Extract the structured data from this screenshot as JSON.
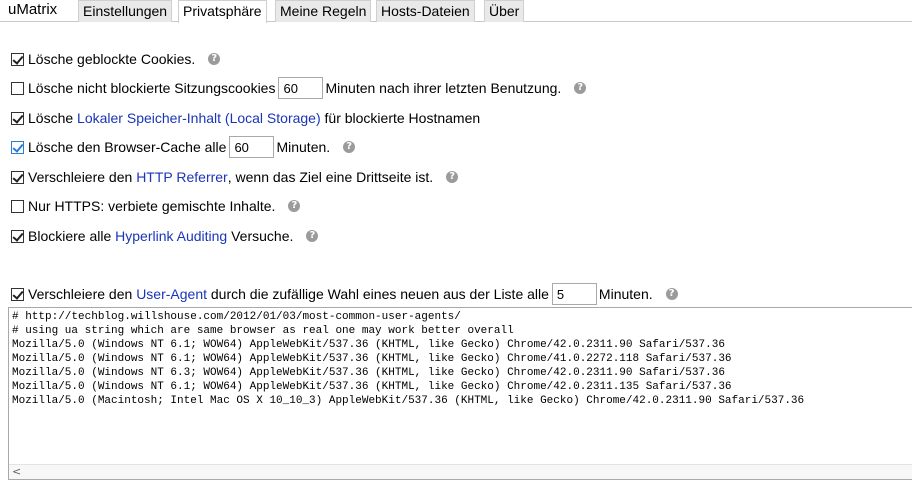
{
  "app": {
    "brand": "uMatrix"
  },
  "tabs": [
    {
      "label": "Einstellungen",
      "active": false
    },
    {
      "label": "Privatsphäre",
      "active": true
    },
    {
      "label": "Meine Regeln",
      "active": false
    },
    {
      "label": "Hosts-Dateien",
      "active": false
    },
    {
      "label": "Über",
      "active": false
    }
  ],
  "options": {
    "delete_blocked_cookies": {
      "checked": true,
      "label": "Lösche geblockte Cookies."
    },
    "delete_session_cookies": {
      "checked": false,
      "label_before": "Lösche nicht blockierte Sitzungscookies",
      "value": "60",
      "label_after": "Minuten nach ihrer letzten Benutzung."
    },
    "delete_local_storage": {
      "checked": true,
      "label_before": "Lösche",
      "link": "Lokaler Speicher-Inhalt (Local Storage)",
      "label_after": "für blockierte Hostnamen"
    },
    "clear_browser_cache": {
      "checked": true,
      "label_before": "Lösche den Browser-Cache alle",
      "value": "60",
      "label_after": "Minuten."
    },
    "spoof_referrer": {
      "checked": true,
      "label_before": "Verschleiere den",
      "link": "HTTP Referrer",
      "label_after": ", wenn das Ziel eine Drittseite ist."
    },
    "https_only": {
      "checked": false,
      "label": "Nur HTTPS: verbiete gemischte Inhalte."
    },
    "block_hyperlink_auditing": {
      "checked": true,
      "label_before": "Blockiere alle",
      "link": "Hyperlink Auditing",
      "label_after": "Versuche."
    },
    "spoof_user_agent": {
      "checked": true,
      "label_before": "Verschleiere den",
      "link": "User-Agent",
      "label_middle": "durch die zufällige Wahl eines neuen aus der Liste alle",
      "value": "5",
      "label_after": "Minuten."
    }
  },
  "help_icon": "question-mark-circle-icon",
  "user_agents": [
    "# http://techblog.willshouse.com/2012/01/03/most-common-user-agents/",
    "# using ua string which are same browser as real one may work better overall",
    "Mozilla/5.0 (Windows NT 6.1; WOW64) AppleWebKit/537.36 (KHTML, like Gecko) Chrome/42.0.2311.90 Safari/537.36",
    "Mozilla/5.0 (Windows NT 6.1; WOW64) AppleWebKit/537.36 (KHTML, like Gecko) Chrome/41.0.2272.118 Safari/537.36",
    "Mozilla/5.0 (Windows NT 6.3; WOW64) AppleWebKit/537.36 (KHTML, like Gecko) Chrome/42.0.2311.90 Safari/537.36",
    "Mozilla/5.0 (Windows NT 6.1; WOW64) AppleWebKit/537.36 (KHTML, like Gecko) Chrome/42.0.2311.135 Safari/537.36",
    "Mozilla/5.0 (Macintosh; Intel Mac OS X 10_10_3) AppleWebKit/537.36 (KHTML, like Gecko) Chrome/42.0.2311.90 Safari/537.36"
  ],
  "colors": {
    "link": "#1a35b8",
    "help": "#9b9b9b"
  }
}
